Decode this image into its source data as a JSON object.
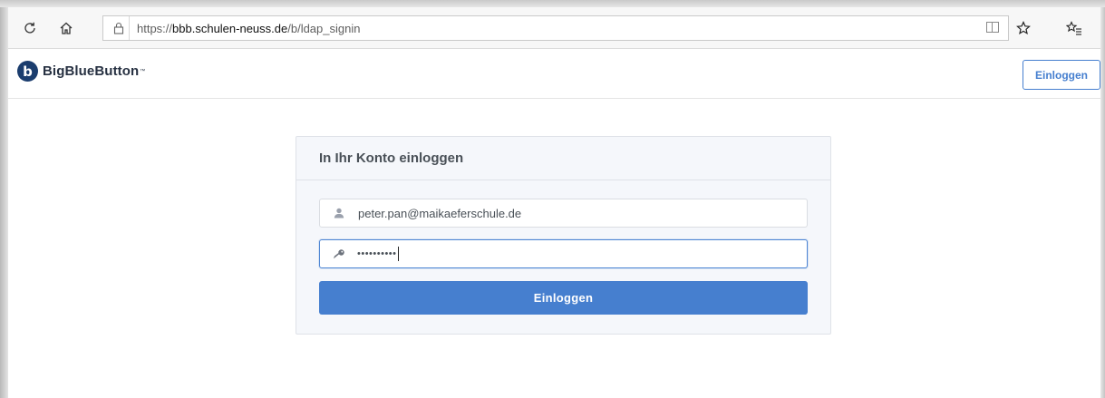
{
  "browser": {
    "url_prefix": "https://",
    "url_domain": "bbb.schulen-neuss.de",
    "url_path": "/b/ldap_signin",
    "icons": [
      "refresh-icon",
      "home-icon",
      "lock-icon",
      "reader-icon",
      "star-icon",
      "favorites-icon"
    ]
  },
  "app": {
    "brand": "BigBlueButton",
    "brand_logo_letter": "b",
    "header_login_label": "Einloggen"
  },
  "login_card": {
    "title": "In Ihr Konto einloggen",
    "email_value": "peter.pan@maikaeferschule.de",
    "password_mask": "••••••••••",
    "submit_label": "Einloggen"
  },
  "colors": {
    "accent": "#467fcf",
    "brand_dark": "#1b3d6e",
    "card_bg": "#f5f7fb"
  }
}
